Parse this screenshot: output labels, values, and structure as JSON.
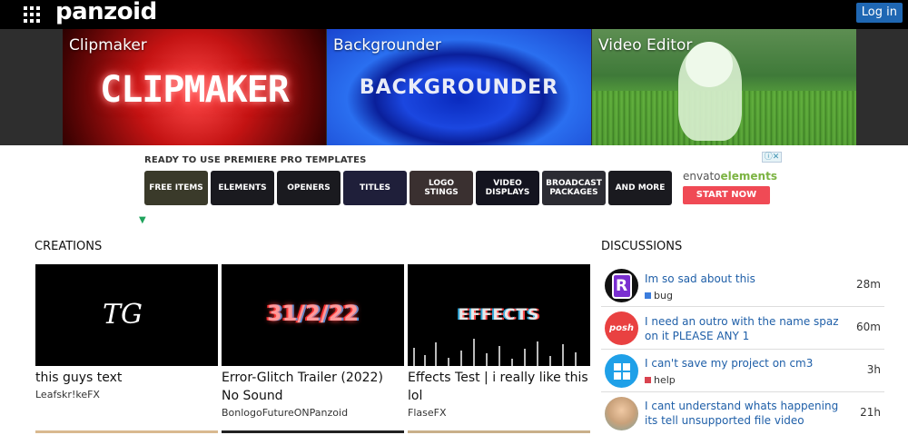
{
  "header": {
    "logo": "panzoid",
    "login_label": "Log in"
  },
  "hero": {
    "tiles": [
      {
        "label": "Clipmaker",
        "art": "CLIPMAKER"
      },
      {
        "label": "Backgrounder",
        "art": "BACKGROUNDER"
      },
      {
        "label": "Video Editor",
        "art": ""
      }
    ]
  },
  "ad": {
    "title": "READY TO USE PREMIERE PRO TEMPLATES",
    "close": "ⓘ✕",
    "buttons": [
      "FREE ITEMS",
      "ELEMENTS",
      "OPENERS",
      "TITLES",
      "LOGO STINGS",
      "VIDEO DISPLAYS",
      "BROADCAST PACKAGES",
      "AND MORE"
    ],
    "brand_prefix": "envato",
    "brand_suffix": "elements",
    "cta": "START NOW",
    "mark": "▼"
  },
  "creations": {
    "heading": "CREATIONS",
    "items": [
      {
        "title": "this guys text",
        "author": "Leafskr!keFX",
        "thumb_text": "TG"
      },
      {
        "title": "Error-Glitch Trailer (2022) No Sound",
        "author": "BonlogoFutureONPanzoid",
        "thumb_text": "31/2/22"
      },
      {
        "title": "Effects Test | i really like this lol",
        "author": "FlaseFX",
        "thumb_text": "EFFECTS"
      }
    ]
  },
  "discussions": {
    "heading": "DISCUSSIONS",
    "items": [
      {
        "title": "Im so sad about this",
        "tag": "bug",
        "tag_color": "#3b7ddd",
        "time": "28m",
        "avatar": "R"
      },
      {
        "title": "I need an outro with the name spaz on it PLEASE ANY 1",
        "tag": "",
        "tag_color": "",
        "time": "60m",
        "avatar": "posh"
      },
      {
        "title": "I can't save my project on cm3",
        "tag": "help",
        "tag_color": "#d9434f",
        "time": "3h",
        "avatar": ""
      },
      {
        "title": "I cant understand whats happening its tell unsupported file video",
        "tag": "",
        "tag_color": "",
        "time": "21h",
        "avatar": ""
      }
    ]
  },
  "colors": {
    "topbar": "#000000",
    "login": "#1f67b3",
    "link": "#1f5fa8",
    "cta": "#f04a55"
  }
}
